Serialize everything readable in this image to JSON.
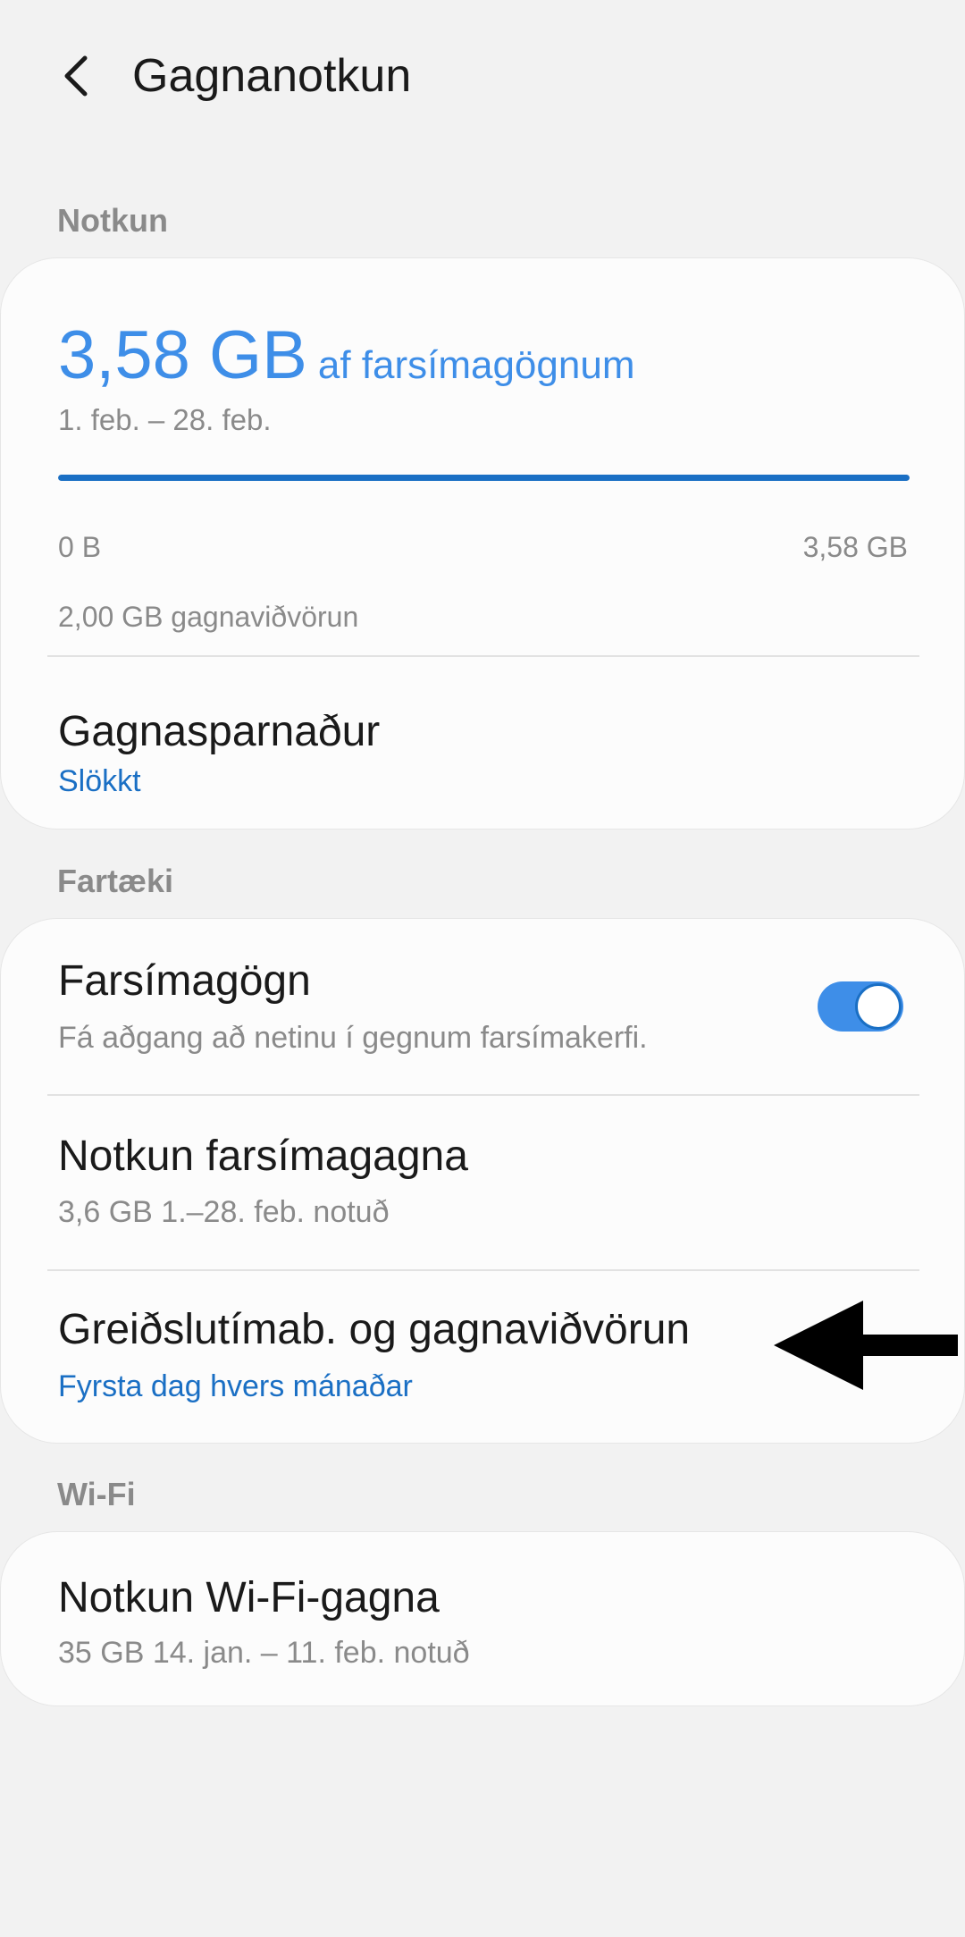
{
  "header": {
    "title": "Gagnanotkun",
    "back_icon": "chevron-left-icon"
  },
  "usage_section": {
    "label": "Notkun",
    "amount": "3,58 GB",
    "amount_suffix": "af farsímagögnum",
    "period": "1. feb. – 28. feb.",
    "progress_fraction": 1.0,
    "range_min": "0 B",
    "range_max": "3,58 GB",
    "warning": "2,00 GB gagnaviðvörun",
    "data_saver": {
      "title": "Gagnasparnaður",
      "status": "Slökkt"
    }
  },
  "device_section": {
    "label": "Fartæki",
    "mobile_data": {
      "title": "Farsímagögn",
      "subtitle": "Fá aðgang að netinu í gegnum farsímakerfi.",
      "enabled": true
    },
    "mobile_usage": {
      "title": "Notkun farsímagagna",
      "subtitle": "3,6 GB 1.–28. feb. notuð"
    },
    "billing": {
      "title": "Greiðslutímab. og gagnaviðvörun",
      "subtitle": "Fyrsta dag hvers mánaðar"
    }
  },
  "wifi_section": {
    "label": "Wi-Fi",
    "wifi_usage": {
      "title": "Notkun Wi-Fi-gagna",
      "subtitle": "35 GB 14. jan. – 11. feb. notuð"
    }
  },
  "colors": {
    "accent": "#3e8ee8",
    "link": "#1a6fc4",
    "background": "#f2f2f2",
    "card": "#fcfcfc",
    "secondary_text": "#8a8a8a"
  },
  "annotation": {
    "icon": "arrow-left-icon",
    "color": "#000000"
  }
}
